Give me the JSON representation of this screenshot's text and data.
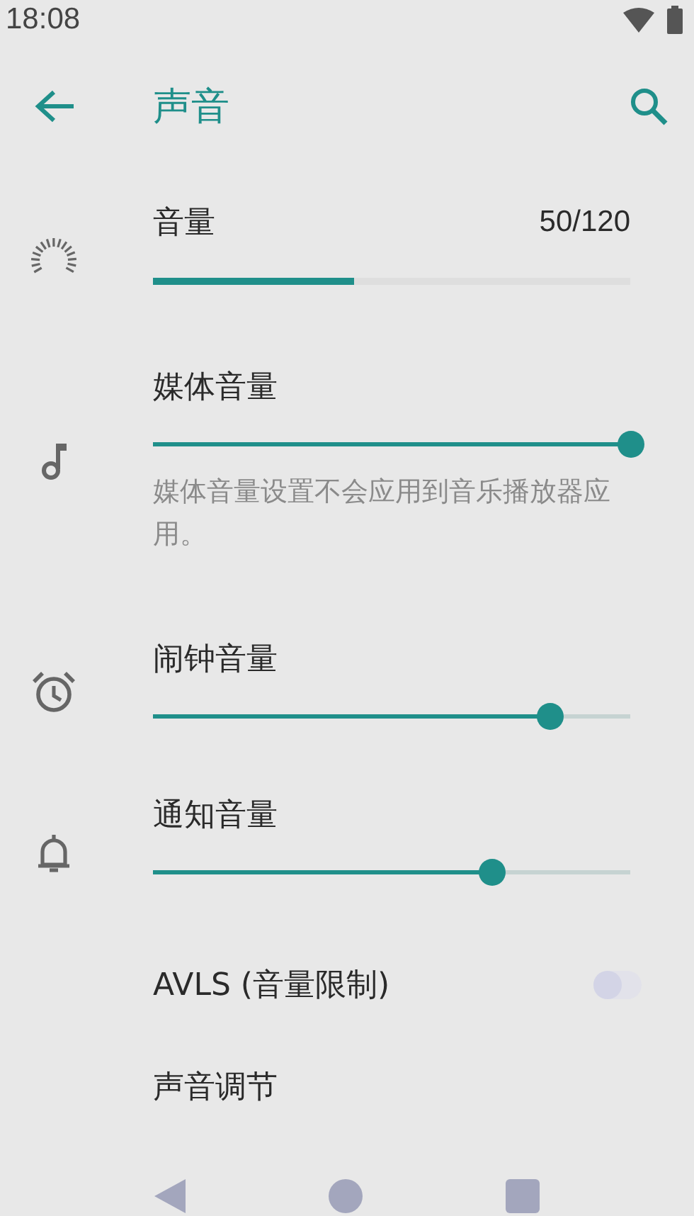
{
  "status_bar": {
    "time": "18:08"
  },
  "toolbar": {
    "title": "声音"
  },
  "items": [
    {
      "kind": "meter",
      "title": "音量",
      "reading": "50/120",
      "level": 0.42
    },
    {
      "kind": "slider",
      "title": "媒体音量",
      "level": 1.0,
      "description": "媒体音量设置不会应用到音乐播放器应用。"
    },
    {
      "kind": "slider",
      "title": "闹钟音量",
      "level": 0.83
    },
    {
      "kind": "slider",
      "title": "通知音量",
      "level": 0.71
    },
    {
      "kind": "switch",
      "title": "AVLS (音量限制)",
      "on": false
    },
    {
      "kind": "plain",
      "title": "声音调节"
    }
  ]
}
